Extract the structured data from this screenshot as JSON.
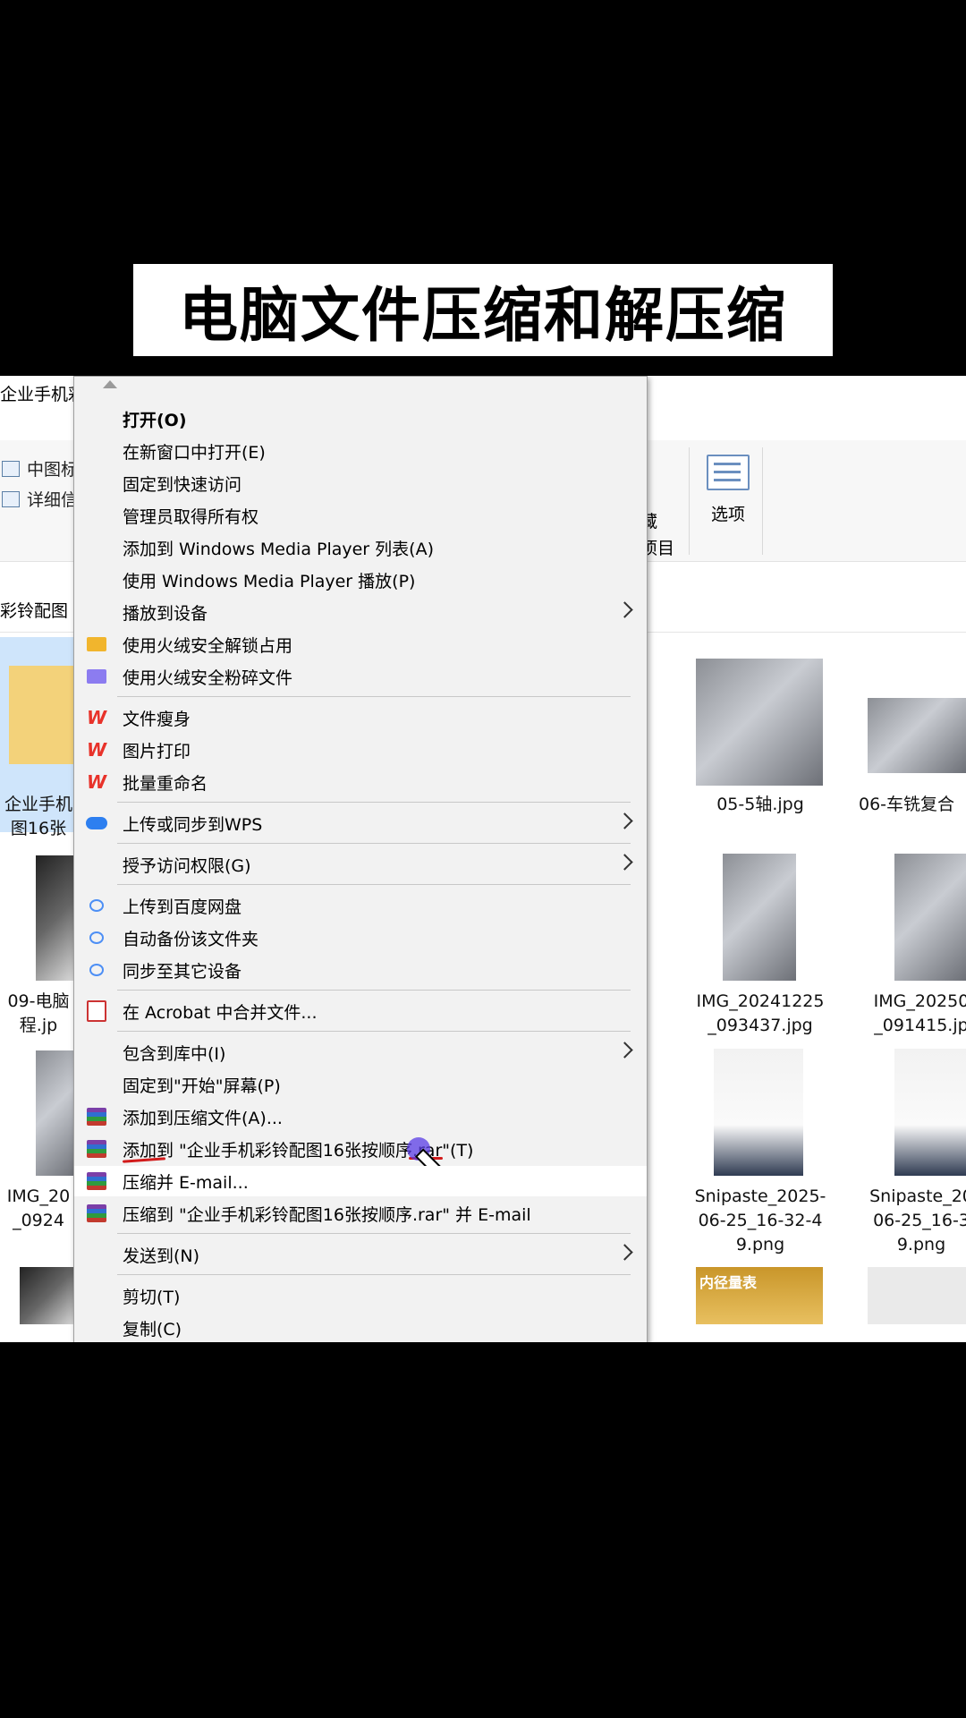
{
  "banner": {
    "title": "电脑文件压缩和解压缩"
  },
  "explorer": {
    "window_title": "企业手机彩",
    "ribbon": {
      "medium_icons": "中图标",
      "details": "详细信",
      "options_label": "选项",
      "hide_partial_1": "藏",
      "hide_partial_2": "项目"
    },
    "address": "彩铃配图"
  },
  "files": [
    {
      "name_line1": "企业手机",
      "name_line2": "图16张",
      "kind": "folder"
    },
    {
      "name_line1": "05-5轴.jpg",
      "name_line2": "",
      "kind": "machine"
    },
    {
      "name_line1": "06-车铣复合",
      "name_line2": "",
      "kind": "machine"
    },
    {
      "name_line1": "09-电脑",
      "name_line2": "程.jp",
      "kind": "dark"
    },
    {
      "name_line1": "IMG_20241225",
      "name_line2": "_093437.jpg",
      "kind": "machine"
    },
    {
      "name_line1": "IMG_20250",
      "name_line2": "_091415.jp",
      "kind": "machine"
    },
    {
      "name_line1": "IMG_20",
      "name_line2": "_0924",
      "kind": "machine"
    },
    {
      "name_line1": "Snipaste_2025-",
      "name_line2": "06-25_16-32-4",
      "name_line3": "9.png",
      "kind": "gauge"
    },
    {
      "name_line1": "Snipaste_20",
      "name_line2": "06-25_16-3",
      "name_line3": "9.png",
      "kind": "gauge"
    },
    {
      "name_line1": "",
      "name_line2": "",
      "kind": "dark"
    },
    {
      "name_line1": "",
      "name_line2": "",
      "kind": "yellow",
      "badge": "内径量表"
    },
    {
      "name_line1": "",
      "name_line2": "",
      "kind": "light"
    }
  ],
  "menu": {
    "items": [
      {
        "label": "打开(O)"
      },
      {
        "label": "在新窗口中打开(E)"
      },
      {
        "label": "固定到快速访问"
      },
      {
        "label": "管理员取得所有权"
      },
      {
        "label": "添加到 Windows Media Player 列表(A)"
      },
      {
        "label": "使用 Windows Media Player 播放(P)"
      },
      {
        "label": "播放到设备"
      },
      {
        "label": "使用火绒安全解锁占用"
      },
      {
        "label": "使用火绒安全粉碎文件"
      },
      {
        "label": "文件瘦身"
      },
      {
        "label": "图片打印"
      },
      {
        "label": "批量重命名"
      },
      {
        "label": "上传或同步到WPS"
      },
      {
        "label": "授予访问权限(G)"
      },
      {
        "label": "上传到百度网盘"
      },
      {
        "label": "自动备份该文件夹"
      },
      {
        "label": "同步至其它设备"
      },
      {
        "label": "在 Acrobat 中合并文件..."
      },
      {
        "label": "包含到库中(I)"
      },
      {
        "label": "固定到\"开始\"屏幕(P)"
      },
      {
        "label": "添加到压缩文件(A)..."
      },
      {
        "label": "添加到 \"企业手机彩铃配图16张按顺序.rar\"(T)"
      },
      {
        "label": "压缩并 E-mail..."
      },
      {
        "label": "压缩到 \"企业手机彩铃配图16张按顺序.rar\" 并 E-mail"
      },
      {
        "label": "发送到(N)"
      },
      {
        "label": "剪切(T)"
      },
      {
        "label": "复制(C)"
      }
    ]
  },
  "colors": {
    "wps_red": "#e8322a",
    "rar_purple": "#7b3fa8",
    "annotation_red": "#d21b1b",
    "cursor_blue": "#5a3ce6"
  }
}
